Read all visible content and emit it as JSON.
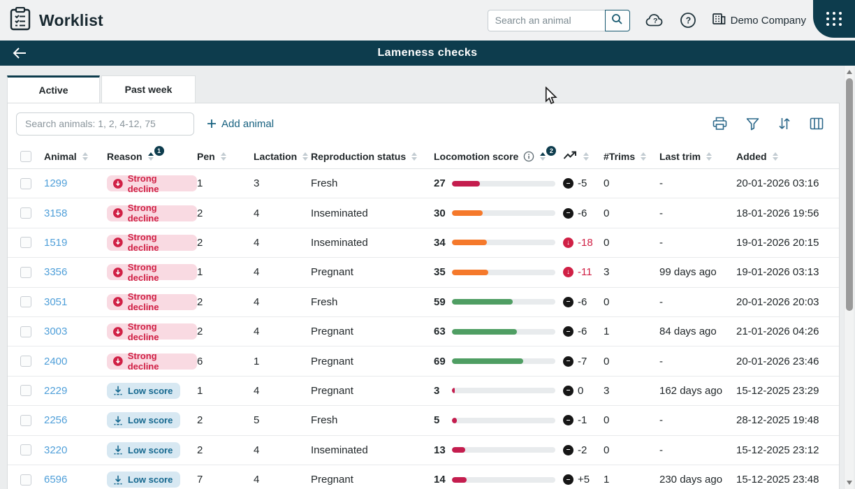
{
  "header": {
    "app_title": "Worklist",
    "search_placeholder": "Search an animal",
    "company_name": "Demo Company"
  },
  "banner": {
    "title": "Lameness checks"
  },
  "tabs": {
    "active": "Active",
    "past_week": "Past week"
  },
  "controls": {
    "animals_search_placeholder": "Search animals: 1, 2, 4-12, 75",
    "add_animal_label": "Add animal"
  },
  "table": {
    "headers": {
      "animal": "Animal",
      "reason": "Reason",
      "pen": "Pen",
      "lactation": "Lactation",
      "repro": "Reproduction status",
      "locomotion": "Locomotion score",
      "trims": "#Trims",
      "last_trim": "Last trim",
      "added": "Added"
    },
    "sort": {
      "reason_badge": "1",
      "locomotion_badge": "2"
    },
    "rows": [
      {
        "animal": "1299",
        "reason": "Strong decline",
        "badge": "strong",
        "pen": "1",
        "lactation": "3",
        "repro": "Fresh",
        "score": 27,
        "bar_color": "#c41d4e",
        "trend": "-5",
        "trend_dir": "flat",
        "trims": "0",
        "last_trim": "-",
        "added": "20-01-2026 03:16"
      },
      {
        "animal": "3158",
        "reason": "Strong decline",
        "badge": "strong",
        "pen": "2",
        "lactation": "4",
        "repro": "Inseminated",
        "score": 30,
        "bar_color": "#f5792b",
        "trend": "-6",
        "trend_dir": "flat",
        "trims": "0",
        "last_trim": "-",
        "added": "18-01-2026 19:56"
      },
      {
        "animal": "1519",
        "reason": "Strong decline",
        "badge": "strong",
        "pen": "2",
        "lactation": "4",
        "repro": "Inseminated",
        "score": 34,
        "bar_color": "#f5792b",
        "trend": "-18",
        "trend_dir": "down",
        "trims": "0",
        "last_trim": "-",
        "added": "19-01-2026 20:15"
      },
      {
        "animal": "3356",
        "reason": "Strong decline",
        "badge": "strong",
        "pen": "1",
        "lactation": "4",
        "repro": "Pregnant",
        "score": 35,
        "bar_color": "#f5792b",
        "trend": "-11",
        "trend_dir": "down",
        "trims": "3",
        "last_trim": "99 days ago",
        "added": "19-01-2026 03:13"
      },
      {
        "animal": "3051",
        "reason": "Strong decline",
        "badge": "strong",
        "pen": "2",
        "lactation": "4",
        "repro": "Fresh",
        "score": 59,
        "bar_color": "#4f9e63",
        "trend": "-6",
        "trend_dir": "flat",
        "trims": "0",
        "last_trim": "-",
        "added": "20-01-2026 20:03"
      },
      {
        "animal": "3003",
        "reason": "Strong decline",
        "badge": "strong",
        "pen": "2",
        "lactation": "4",
        "repro": "Pregnant",
        "score": 63,
        "bar_color": "#4f9e63",
        "trend": "-6",
        "trend_dir": "flat",
        "trims": "1",
        "last_trim": "84 days ago",
        "added": "21-01-2026 04:26"
      },
      {
        "animal": "2400",
        "reason": "Strong decline",
        "badge": "strong",
        "pen": "6",
        "lactation": "1",
        "repro": "Pregnant",
        "score": 69,
        "bar_color": "#4f9e63",
        "trend": "-7",
        "trend_dir": "flat",
        "trims": "0",
        "last_trim": "-",
        "added": "20-01-2026 23:46"
      },
      {
        "animal": "2229",
        "reason": "Low score",
        "badge": "low",
        "pen": "1",
        "lactation": "4",
        "repro": "Pregnant",
        "score": 3,
        "bar_color": "#c41d4e",
        "trend": "0",
        "trend_dir": "flat",
        "trims": "3",
        "last_trim": "162 days ago",
        "added": "15-12-2025 23:29"
      },
      {
        "animal": "2256",
        "reason": "Low score",
        "badge": "low",
        "pen": "2",
        "lactation": "5",
        "repro": "Fresh",
        "score": 5,
        "bar_color": "#c41d4e",
        "trend": "-1",
        "trend_dir": "flat",
        "trims": "0",
        "last_trim": "-",
        "added": "28-12-2025 19:48"
      },
      {
        "animal": "3220",
        "reason": "Low score",
        "badge": "low",
        "pen": "2",
        "lactation": "4",
        "repro": "Inseminated",
        "score": 13,
        "bar_color": "#c41d4e",
        "trend": "-2",
        "trend_dir": "flat",
        "trims": "0",
        "last_trim": "-",
        "added": "15-12-2025 23:12"
      },
      {
        "animal": "6596",
        "reason": "Low score",
        "badge": "low",
        "pen": "7",
        "lactation": "4",
        "repro": "Pregnant",
        "score": 14,
        "bar_color": "#c41d4e",
        "trend": "+5",
        "trend_dir": "flat",
        "trims": "1",
        "last_trim": "230 days ago",
        "added": "15-12-2025 23:48"
      }
    ]
  },
  "colors": {
    "accent_dark_teal": "#0d3c4d",
    "link_blue": "#4f9fd9",
    "action_teal": "#16607f",
    "bar_red": "#c41d4e",
    "bar_orange": "#f5792b",
    "bar_green": "#4f9e63",
    "decline_red": "#d02045",
    "low_score_blue": "#15688f"
  }
}
